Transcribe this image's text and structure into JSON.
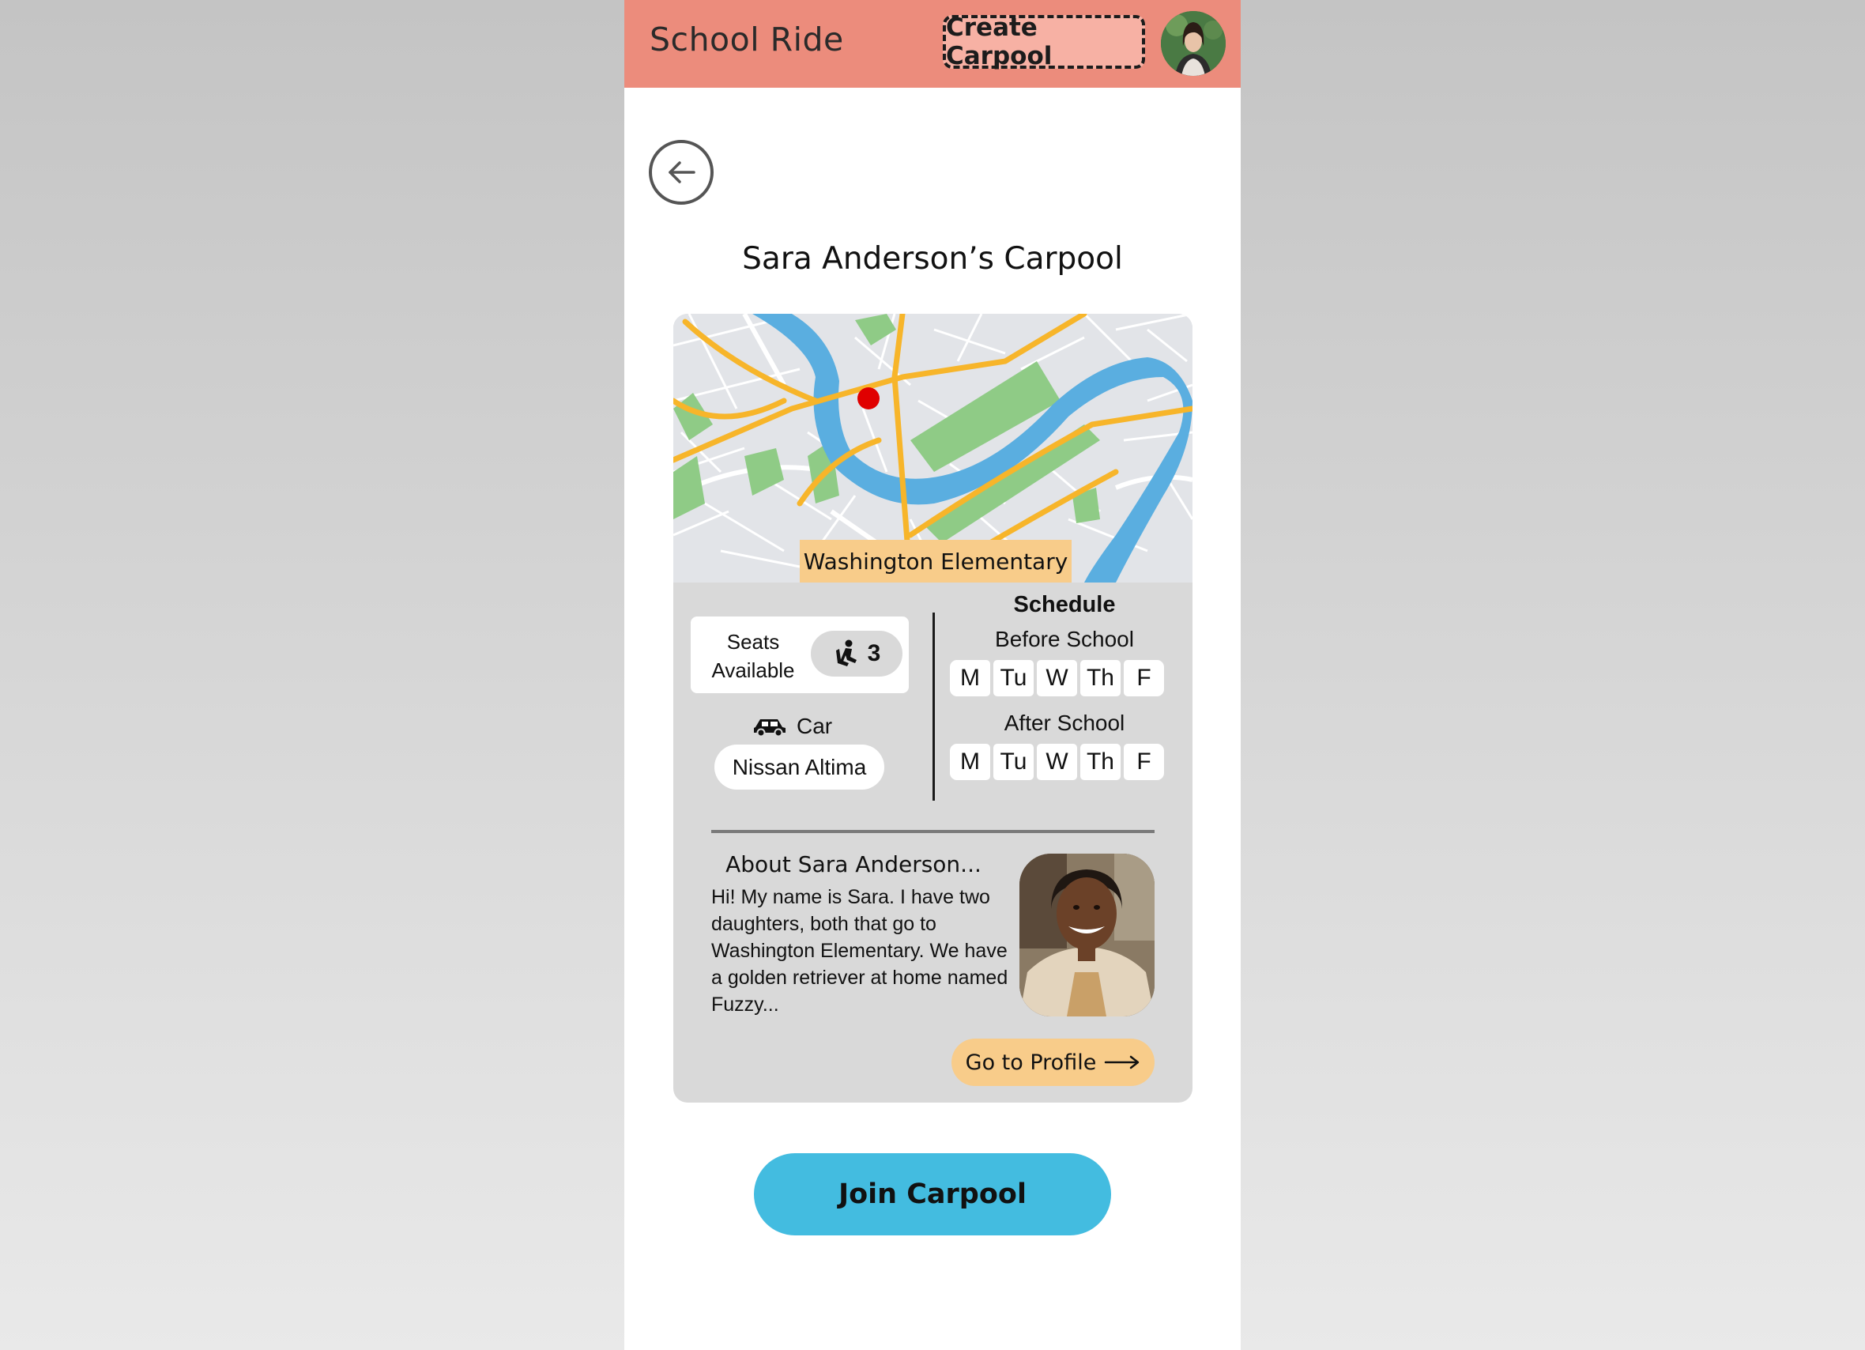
{
  "header": {
    "brand": "School Ride",
    "create_button": "Create Carpool"
  },
  "page": {
    "title": "Sara Anderson’s Carpool"
  },
  "map": {
    "destination_label": "Washington Elementary"
  },
  "seats": {
    "label_line1": "Seats",
    "label_line2": "Available",
    "count": "3"
  },
  "car": {
    "label": "Car",
    "model": "Nissan Altima"
  },
  "schedule": {
    "title": "Schedule",
    "before_label": "Before School",
    "after_label": "After School",
    "days": [
      "M",
      "Tu",
      "W",
      "Th",
      "F"
    ]
  },
  "about": {
    "title": "About Sara Anderson...",
    "text": "Hi! My name is Sara. I have two daughters, both that go to Washington Elementary. We have a golden retriever at home named Fuzzy...",
    "profile_button": "Go to Profile"
  },
  "actions": {
    "join_button": "Join Carpool"
  },
  "colors": {
    "header_bg": "#ec8c7c",
    "create_btn_bg": "#f7b1a4",
    "card_bg": "#d9d9d9",
    "highlight": "#f8cc8a",
    "join_btn": "#43bce0",
    "river": "#5aaee0",
    "road": "#f7b52a",
    "park": "#8fcb86",
    "map_pin": "#e00000"
  }
}
